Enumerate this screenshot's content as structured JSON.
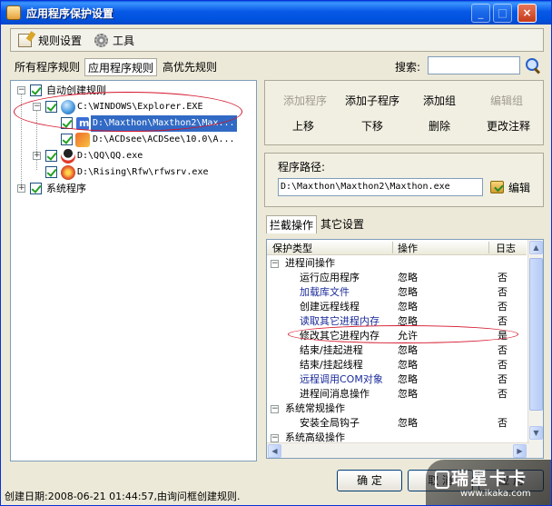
{
  "window": {
    "title": "应用程序保护设置"
  },
  "toolbar": {
    "rules_label": "规则设置",
    "tools_label": "工具"
  },
  "tabs": [
    {
      "label": "所有程序规则"
    },
    {
      "label": "应用程序规则"
    },
    {
      "label": "高优先规则"
    }
  ],
  "search": {
    "label": "搜索:",
    "value": ""
  },
  "tree": {
    "root1": "自动创建规则",
    "items": [
      "C:\\WINDOWS\\Explorer.EXE",
      "D:\\Maxthon\\Maxthon2\\Max...",
      "D:\\ACDsee\\ACDSee\\10.0\\A...",
      "D:\\QQ\\QQ.exe",
      "D:\\Rising\\Rfw\\rfwsrv.exe"
    ],
    "root2": "系统程序"
  },
  "buttons": {
    "add_program": "添加程序",
    "add_child": "添加子程序",
    "add_group": "添加组",
    "edit_group": "编辑组",
    "move_up": "上移",
    "move_down": "下移",
    "delete": "删除",
    "edit_note": "更改注释"
  },
  "path": {
    "label": "程序路径:",
    "value": "D:\\Maxthon\\Maxthon2\\Maxthon.exe",
    "edit_label": "编辑"
  },
  "subtabs": [
    {
      "label": "拦截操作"
    },
    {
      "label": "其它设置"
    }
  ],
  "grid": {
    "headers": [
      "保护类型",
      "操作",
      "日志"
    ],
    "rows": [
      {
        "type": "进程间操作",
        "group": true
      },
      {
        "type": "运行应用程序",
        "action": "忽略",
        "log": "否"
      },
      {
        "type": "加载库文件",
        "action": "忽略",
        "log": "否"
      },
      {
        "type": "创建远程线程",
        "action": "忽略",
        "log": "否"
      },
      {
        "type": "读取其它进程内存",
        "action": "忽略",
        "log": "否"
      },
      {
        "type": "修改其它进程内存",
        "action": "允许",
        "log": "是"
      },
      {
        "type": "结束/挂起进程",
        "action": "忽略",
        "log": "否"
      },
      {
        "type": "结束/挂起线程",
        "action": "忽略",
        "log": "否"
      },
      {
        "type": "远程调用COM对象",
        "action": "忽略",
        "log": "否"
      },
      {
        "type": "进程间消息操作",
        "action": "忽略",
        "log": "否"
      },
      {
        "type": "系统常规操作",
        "group": true
      },
      {
        "type": "安装全局钩子",
        "action": "忽略",
        "log": "否"
      },
      {
        "type": "系统高级操作",
        "group": true
      }
    ]
  },
  "status": {
    "text": "创建日期:2008-06-21 01:44:57,由询问框创建规则."
  },
  "footer": {
    "ok_label": "确 定",
    "cancel_label": "取 消",
    "apply_label": "应 用"
  },
  "watermark": {
    "big": "瑞星卡卡",
    "small": "www.ikaka.com"
  }
}
